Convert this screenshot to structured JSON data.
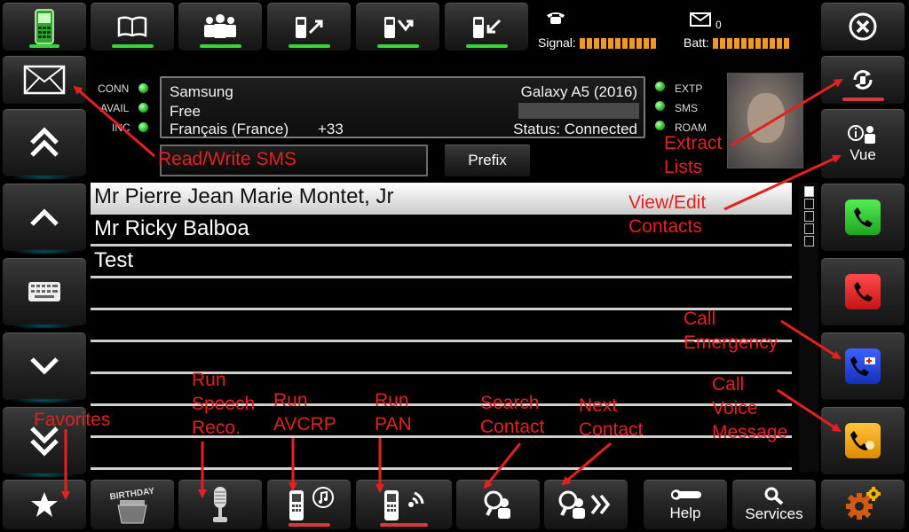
{
  "status": {
    "signal_label": "Signal:",
    "batt_label": "Batt:",
    "sms_count": "0",
    "leds_left": [
      "CONN",
      "AVAIL",
      "INC"
    ],
    "leds_right": [
      "EXTP",
      "SMS",
      "ROAM"
    ]
  },
  "device": {
    "brand": "Samsung",
    "model": "Galaxy A5 (2016)",
    "carrier": "Free",
    "language": "Français (France)",
    "country_code": "+33",
    "status": "Status: Connected"
  },
  "prefix_button": "Prefix",
  "vue_label": "Vue",
  "contacts": [
    "Mr Pierre Jean Marie Montet, Jr",
    "Mr Ricky Balboa",
    "Test",
    "",
    "",
    "",
    "",
    "",
    ""
  ],
  "bottom": {
    "help_label": "Help",
    "services_label": "Services",
    "birthday_label": "BIRTHDAY"
  },
  "annotations": {
    "read_write_sms": "Read/Write SMS",
    "extract_lists": "Extract\nLists",
    "view_edit_contacts": "View/Edit\nContacts",
    "call_emergency": "Call\nEmergency",
    "call_voice_message": "Call\nVoice\nMessage",
    "favorites": "Favorites",
    "run_speech_reco": "Run\nSpeech\nReco.",
    "run_avcrp": "Run\nAVCRP",
    "run_pan": "Run\nPAN",
    "search_contact": "Search\nContact",
    "next_contact": "Next\nContact"
  },
  "icons": {
    "top_row": [
      "phone-green-icon",
      "book-icon",
      "people-icon",
      "phone-out-icon",
      "phone-missed-icon",
      "phone-in-icon"
    ],
    "left_col": [
      "envelope-icon",
      "double-chevron-up-icon",
      "chevron-up-icon",
      "keyboard-icon",
      "chevron-down-icon",
      "double-chevron-down-icon"
    ],
    "right_col": [
      "close-icon",
      "sync-icon",
      "info-person-icon",
      "call-green-icon",
      "call-red-icon",
      "emergency-call-icon",
      "voicemail-call-icon"
    ],
    "bottom_row": [
      "star-icon",
      "birthday-cake-icon",
      "microphone-icon",
      "phone-music-icon",
      "phone-wifi-icon",
      "search-contact-icon",
      "next-contact-icon",
      "wrench-icon",
      "magnifier-icon",
      "settings-gears-icon"
    ]
  },
  "colors": {
    "accent_orange": "#f39a1e",
    "led_green": "#2fbb2f",
    "call_green": "#2ec82e",
    "call_red": "#e01c1c",
    "emergency_blue": "#1f3fd6",
    "voicemail_orange": "#f2a012",
    "annotation_red": "#e62020"
  }
}
